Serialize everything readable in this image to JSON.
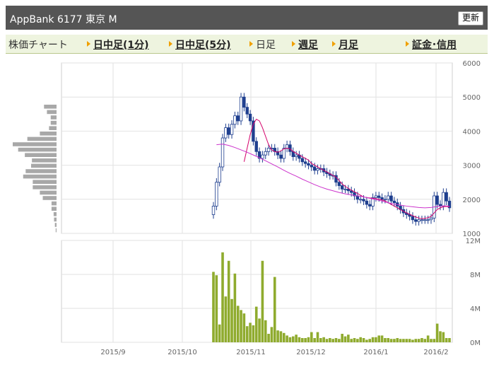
{
  "header": {
    "title": "AppBank  6177  東京 M",
    "refresh_label": "更新"
  },
  "tabs": [
    {
      "label": "株価チャート",
      "link": false,
      "arrow": false
    },
    {
      "label": "日中足(1分)",
      "link": true,
      "arrow": true
    },
    {
      "label": "日中足(5分)",
      "link": true,
      "arrow": true
    },
    {
      "label": "日足",
      "link": false,
      "arrow": true
    },
    {
      "label": "週足",
      "link": true,
      "arrow": true
    },
    {
      "label": "月足",
      "link": true,
      "arrow": true
    },
    {
      "label": "証金･信用",
      "link": true,
      "arrow": true
    }
  ],
  "colors": {
    "candle": "#1f3f8f",
    "ma": "#d4006a",
    "ma_long": "#cc33cc",
    "volume": "#8fab2e",
    "profile": "#a8a8a8"
  },
  "chart_data": [
    {
      "type": "candlestick",
      "ylim": [
        1000,
        6000
      ],
      "y_ticks": [
        "6000",
        "5000",
        "4000",
        "3000",
        "2000",
        "1000"
      ],
      "x_ticks": [
        "2015/9",
        "2015/10",
        "2015/11",
        "2015/12",
        "2016/1",
        "2016/2"
      ],
      "close": [
        1800,
        2500,
        2950,
        3800,
        4100,
        3900,
        4200,
        4450,
        4300,
        5000,
        4700,
        4500,
        4300,
        3700,
        3400,
        3200,
        3300,
        3400,
        3500,
        3500,
        3400,
        3300,
        3200,
        3500,
        3600,
        3400,
        3250,
        3300,
        3200,
        3100,
        3050,
        3000,
        2950,
        2850,
        2900,
        2900,
        2800,
        2750,
        2700,
        2700,
        2500,
        2400,
        2300,
        2300,
        2250,
        2200,
        2100,
        2000,
        2000,
        1950,
        1850,
        1800,
        2050,
        2100,
        2050,
        2000,
        2000,
        2100,
        1950,
        1900,
        1800,
        1700,
        1600,
        1550,
        1500,
        1400,
        1350,
        1400,
        1400,
        1400,
        1400,
        1450,
        2100,
        1850,
        1800,
        2200,
        1950,
        1750
      ],
      "ma_short": [
        3100,
        3500,
        3900,
        4200,
        4350,
        4300,
        4100,
        3850,
        3600,
        3450,
        3400,
        3380,
        3420,
        3480,
        3500,
        3480,
        3400,
        3350,
        3300,
        3250,
        3200,
        3150,
        3050,
        3000,
        2950,
        2900,
        2850,
        2800,
        2750,
        2700,
        2650,
        2550,
        2450,
        2380,
        2320,
        2270,
        2220,
        2170,
        2120,
        2070,
        2050,
        2040,
        2030,
        2020,
        2000,
        1980,
        1950,
        1900,
        1850,
        1800,
        1750,
        1700,
        1650,
        1600,
        1560,
        1520,
        1480,
        1450,
        1430,
        1440,
        1460,
        1500,
        1600,
        1700,
        1750,
        1780,
        1790,
        1780
      ],
      "ma_long": [
        3600,
        3620,
        3580,
        3520,
        3450,
        3380,
        3300,
        3220,
        3130,
        3040,
        2950,
        2850,
        2760,
        2680,
        2590,
        2510,
        2430,
        2360,
        2300,
        2250,
        2200,
        2160,
        2130,
        2100,
        2070,
        2030,
        1990,
        1950,
        1900,
        1860,
        1830,
        1800,
        1780,
        1760,
        1750,
        1760,
        1790,
        1810,
        1800
      ],
      "price_profile": [
        300,
        230,
        140,
        140,
        180,
        400,
        700,
        1050,
        920,
        760,
        590,
        610,
        740,
        800,
        570,
        570,
        400,
        330,
        120,
        120,
        70,
        60,
        40,
        20
      ]
    },
    {
      "type": "bar",
      "ylim": [
        0,
        12
      ],
      "ylabel_unit": "M",
      "y_ticks": [
        "12M",
        "8M",
        "4M",
        "0M"
      ],
      "values": [
        8.3,
        7.9,
        2.1,
        10.6,
        5.4,
        9.6,
        5.1,
        8.1,
        4.3,
        3.8,
        3.4,
        1.9,
        2.3,
        2.0,
        4.2,
        2.8,
        9.6,
        2.6,
        1.0,
        1.8,
        7.7,
        1.4,
        1.3,
        1.1,
        0.8,
        0.6,
        0.7,
        0.9,
        0.6,
        0.5,
        0.5,
        0.6,
        1.2,
        0.5,
        1.2,
        0.5,
        0.6,
        0.4,
        0.5,
        0.4,
        0.5,
        0.4,
        1.0,
        0.7,
        0.9,
        0.4,
        0.5,
        0.4,
        0.6,
        0.5,
        0.3,
        0.4,
        0.6,
        0.6,
        0.8,
        0.8,
        0.5,
        0.5,
        0.4,
        0.4,
        0.5,
        0.4,
        0.4,
        0.4,
        0.4,
        0.3,
        0.4,
        0.4,
        0.5,
        0.4,
        0.8,
        0.4,
        0.4,
        2.2,
        1.3,
        1.2,
        0.5,
        0.5
      ]
    }
  ]
}
